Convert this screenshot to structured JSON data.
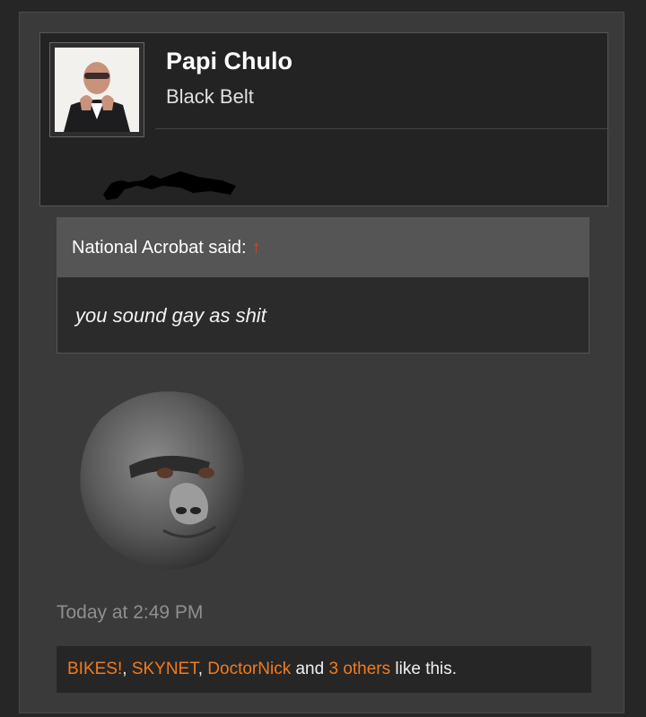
{
  "post": {
    "author": {
      "name": "Papi Chulo",
      "title": "Black Belt"
    },
    "quote": {
      "author_line": "National Acrobat said:",
      "arrow_icon": "↑",
      "text": "you sound gay as shit"
    },
    "timestamp": "Today at 2:49 PM",
    "likes": {
      "users": [
        "BIKES!",
        "SKYNET",
        "DoctorNick"
      ],
      "sep": ", ",
      "and_text": "and",
      "others_link": "3 others",
      "suffix": "like this."
    }
  },
  "colors": {
    "link": "#f07b1f",
    "quote_arrow": "#d9452a"
  }
}
